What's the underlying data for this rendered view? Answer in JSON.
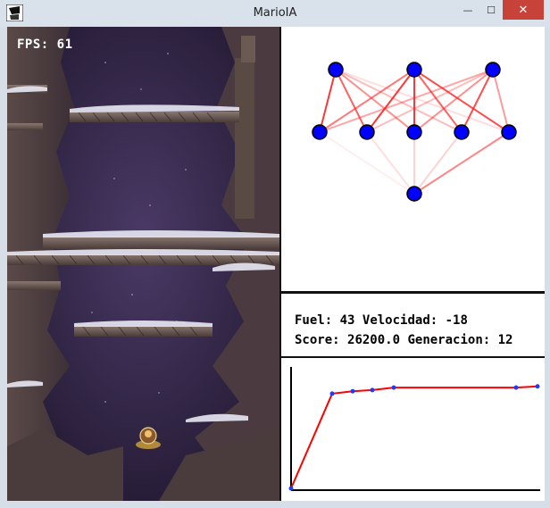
{
  "window": {
    "title": "MarioIA",
    "controls": {
      "minimize": "—",
      "maximize": "☐",
      "close": "✕"
    }
  },
  "game": {
    "fps_label": "FPS:",
    "fps_value": "61"
  },
  "stats": {
    "fuel_label": "Fuel:",
    "fuel_value": "43",
    "velocity_label": "Velocidad:",
    "velocity_value": "-18",
    "score_label": "Score:",
    "score_value": "26200.0",
    "generation_label": "Generacion:",
    "generation_value": "12"
  },
  "network": {
    "input_nodes": 3,
    "hidden_nodes": 5,
    "output_nodes": 1,
    "node_color": "#0000ff",
    "edge_color": "#ff2020"
  },
  "colors": {
    "titlebar": "#d9e1ea",
    "close_button": "#c7433a",
    "graph_line": "#ff0000",
    "graph_point": "#1e3cff"
  },
  "chart_data": {
    "type": "line",
    "points_relative": [
      0.0,
      0.78,
      0.8,
      0.81,
      0.83,
      0.83,
      0.83,
      0.83,
      0.84
    ],
    "x_index": [
      0,
      1,
      2,
      3,
      4,
      5,
      6,
      7,
      8
    ]
  }
}
